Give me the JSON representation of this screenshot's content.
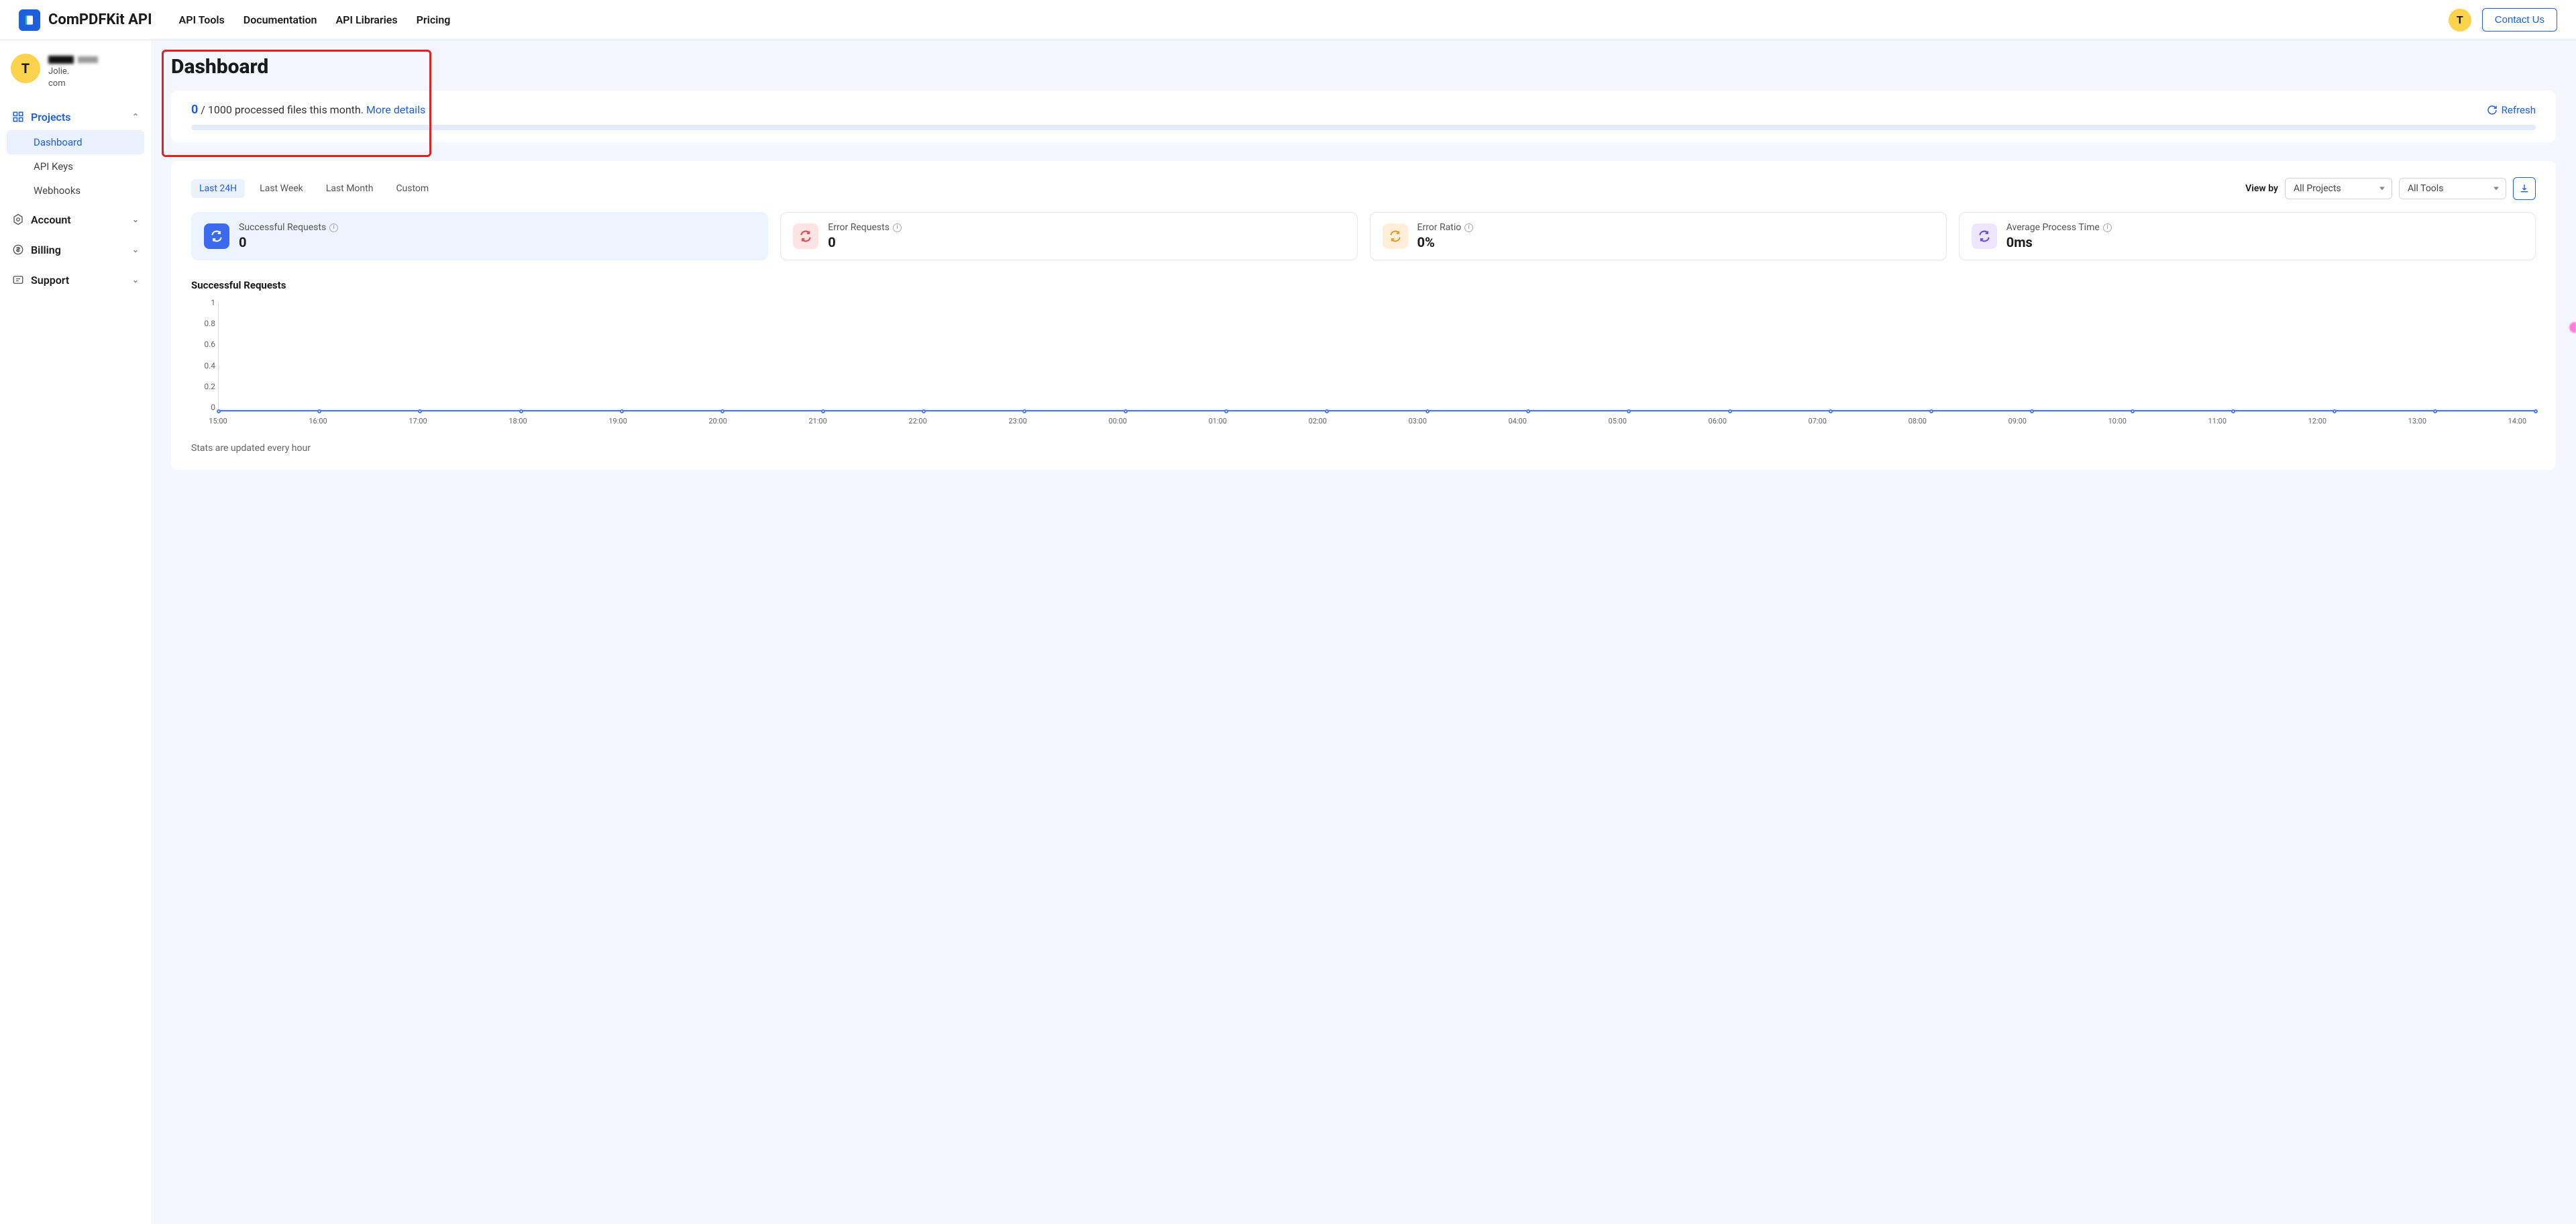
{
  "header": {
    "brand": "ComPDFKit API",
    "nav": {
      "tools": "API Tools",
      "docs": "Documentation",
      "libs": "API Libraries",
      "pricing": "Pricing"
    },
    "avatar_initial": "T",
    "contact": "Contact Us"
  },
  "sidebar": {
    "avatar_initial": "T",
    "user_line2": "Jolie.",
    "user_line3": "com",
    "sections": {
      "projects": {
        "label": "Projects",
        "items": {
          "dashboard": "Dashboard",
          "apikeys": "API Keys",
          "webhooks": "Webhooks"
        }
      },
      "account": {
        "label": "Account"
      },
      "billing": {
        "label": "Billing"
      },
      "support": {
        "label": "Support"
      }
    }
  },
  "page": {
    "title": "Dashboard",
    "quota_current": "0",
    "quota_sep": " / ",
    "quota_total": "1000 processed files this month. ",
    "more_details": "More details",
    "refresh": "Refresh"
  },
  "filters": {
    "ranges": {
      "last24h": "Last 24H",
      "lastweek": "Last Week",
      "lastmonth": "Last Month",
      "custom": "Custom"
    },
    "viewby_label": "View by",
    "projects_select": "All Projects",
    "tools_select": "All Tools"
  },
  "stats": {
    "successful": {
      "label": "Successful Requests",
      "value": "0"
    },
    "error": {
      "label": "Error Requests",
      "value": "0"
    },
    "ratio": {
      "label": "Error Ratio",
      "value": "0%"
    },
    "avg": {
      "label": "Average Process Time",
      "value": "0ms"
    }
  },
  "chart": {
    "title": "Successful Requests",
    "footnote": "Stats are updated every hour"
  },
  "chart_data": {
    "type": "line",
    "title": "Successful Requests",
    "xlabel": "",
    "ylabel": "",
    "ylim": [
      0,
      1
    ],
    "y_ticks": [
      "1",
      "0.8",
      "0.6",
      "0.4",
      "0.2",
      "0"
    ],
    "categories": [
      "15:00",
      "16:00",
      "17:00",
      "18:00",
      "19:00",
      "20:00",
      "21:00",
      "22:00",
      "23:00",
      "00:00",
      "01:00",
      "02:00",
      "03:00",
      "04:00",
      "05:00",
      "06:00",
      "07:00",
      "08:00",
      "09:00",
      "10:00",
      "11:00",
      "12:00",
      "13:00",
      "14:00"
    ],
    "series": [
      {
        "name": "Successful Requests",
        "values": [
          0,
          0,
          0,
          0,
          0,
          0,
          0,
          0,
          0,
          0,
          0,
          0,
          0,
          0,
          0,
          0,
          0,
          0,
          0,
          0,
          0,
          0,
          0,
          0
        ]
      }
    ]
  }
}
